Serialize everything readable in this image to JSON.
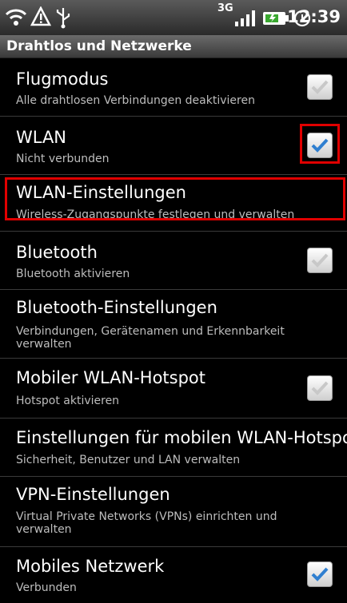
{
  "status": {
    "time": "12:39",
    "network": "3G"
  },
  "header": {
    "title": "Drahtlos und Netzwerke"
  },
  "items": [
    {
      "title": "Flugmodus",
      "summary": "Alle drahtlosen Verbindungen deaktivieren",
      "checked": false
    },
    {
      "title": "WLAN",
      "summary": "Nicht verbunden",
      "checked": true
    },
    {
      "title": "WLAN-Einstellungen",
      "summary": "Wireless-Zugangspunkte festlegen und verwalten"
    },
    {
      "title": "Bluetooth",
      "summary": "Bluetooth aktivieren",
      "checked": false
    },
    {
      "title": "Bluetooth-Einstellungen",
      "summary": "Verbindungen, Gerätenamen und Erkennbarkeit verwalten"
    },
    {
      "title": "Mobiler WLAN-Hotspot",
      "summary": "Hotspot aktivieren",
      "checked": false
    },
    {
      "title": "Einstellungen für mobilen WLAN-Hotspot",
      "summary": "Sicherheit, Benutzer und LAN verwalten"
    },
    {
      "title": "VPN-Einstellungen",
      "summary": "Virtual Private Networks (VPNs) einrichten und verwalten"
    },
    {
      "title": "Mobiles Netzwerk",
      "summary": "Verbunden",
      "checked": true
    }
  ],
  "colors": {
    "highlight": "#e00000",
    "check": "#2f7fd0"
  }
}
